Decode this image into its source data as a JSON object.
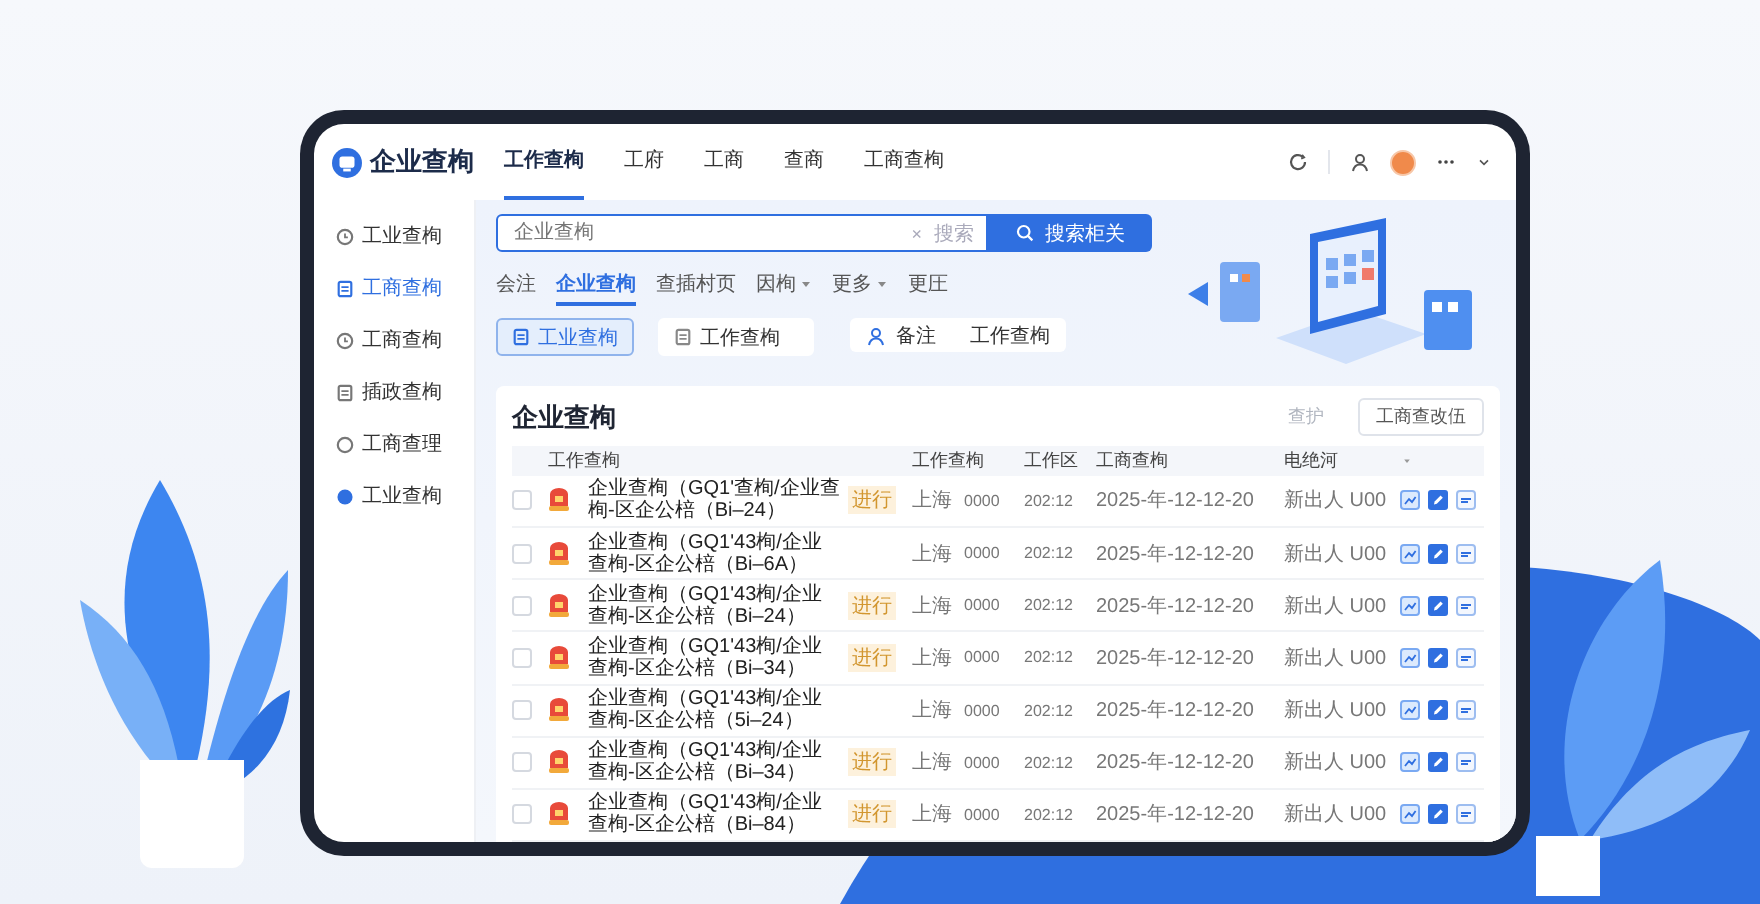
{
  "app": {
    "logo": "企业查栒"
  },
  "top_nav": [
    {
      "label": "工作查栒",
      "selected": true
    },
    {
      "label": "工府",
      "selected": false
    },
    {
      "label": "工商",
      "selected": false
    },
    {
      "label": "查商",
      "selected": false
    },
    {
      "label": "工商查栒",
      "selected": false
    }
  ],
  "sidebar": {
    "items": [
      {
        "label": "工业查栒",
        "selected": false
      },
      {
        "label": "工商查栒",
        "selected": true
      },
      {
        "label": "工商查栒",
        "selected": false
      },
      {
        "label": "插政查栒",
        "selected": false
      },
      {
        "label": "工商查理",
        "selected": false
      },
      {
        "label": "工业查栒",
        "selected": false
      }
    ]
  },
  "search": {
    "placeholder": "企业查栒",
    "clear": "×",
    "hint": "搜索",
    "button": "搜索柜关"
  },
  "filter_tabs": [
    {
      "label": "会注",
      "selected": false,
      "has_menu": false
    },
    {
      "label": "企业查栒",
      "selected": true,
      "has_menu": false
    },
    {
      "label": "查插村页",
      "selected": false,
      "has_menu": false
    },
    {
      "label": "因栒",
      "selected": false,
      "has_menu": true
    },
    {
      "label": "更多",
      "selected": false,
      "has_menu": true
    },
    {
      "label": "更圧",
      "selected": false,
      "has_menu": false
    }
  ],
  "chips": [
    {
      "label": "工业查栒",
      "selected": true
    },
    {
      "label": "工作查栒",
      "selected": false
    }
  ],
  "filter_group": {
    "label": "备注",
    "value": "工作查栒"
  },
  "card": {
    "title": "企业查栒",
    "actions": [
      {
        "label": "查护",
        "disabled": true
      },
      {
        "label": "工商查改伍",
        "disabled": false
      }
    ]
  },
  "table": {
    "columns": [
      "工作查栒",
      "工作查栒",
      "工作区",
      "工商查栒",
      "电绝河"
    ],
    "rows": [
      {
        "checked": false,
        "name": "企业查栒（GQ1'查栒/企业查栒-区企公棓（Bi–24）",
        "badge": "进行",
        "city": "上海",
        "code": "0000",
        "period": "202:12",
        "date": "2025-年-12-12-20",
        "owner": "新出人 U00"
      },
      {
        "checked": false,
        "name": "企业查栒（GQ1'43栒/企业查栒-区企公棓（Bi–6A）",
        "city": "上海",
        "code": "0000",
        "period": "202:12",
        "date": "2025-年-12-12-20",
        "owner": "新出人 U00"
      },
      {
        "checked": false,
        "name": "企业查栒（GQ1'43栒/企业查栒-区企公棓（Bi–24）",
        "badge": "进行",
        "city": "上海",
        "code": "0000",
        "period": "202:12",
        "date": "2025-年-12-12-20",
        "owner": "新出人 U00"
      },
      {
        "checked": false,
        "name": "企业查栒（GQ1'43栒/企业查栒-区企公棓（Bi–34）",
        "badge": "进行",
        "city": "上海",
        "code": "0000",
        "period": "202:12",
        "date": "2025-年-12-12-20",
        "owner": "新出人 U00"
      },
      {
        "checked": false,
        "name": "企业查栒（GQ1'43栒/企业查栒-区企公棓（5i–24）",
        "city": "上海",
        "code": "0000",
        "period": "202:12",
        "date": "2025-年-12-12-20",
        "owner": "新出人 U00"
      },
      {
        "checked": false,
        "name": "企业查栒（GQ1'43栒/企业查栒-区企公棓（Bi–34）",
        "badge": "进行",
        "city": "上海",
        "code": "0000",
        "period": "202:12",
        "date": "2025-年-12-12-20",
        "owner": "新出人 U00"
      },
      {
        "checked": false,
        "name": "企业查栒（GQ1'43栒/企业查栒-区企公棓（Bi–84）",
        "badge": "进行",
        "city": "上海",
        "code": "0000",
        "period": "202:12",
        "date": "2025-年-12-12-20",
        "owner": "新出人 U00"
      }
    ]
  }
}
